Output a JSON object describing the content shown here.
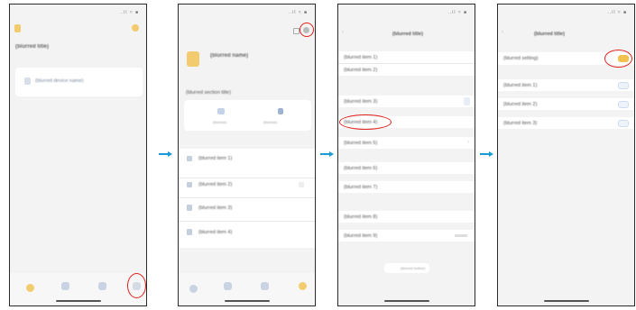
{
  "colors": {
    "accent": "#f2c14e",
    "arrow": "#1a9ad6",
    "highlight": "#e0221e",
    "frame": "#2a2a2a"
  },
  "screen1": {
    "status": "..il ≈ ■",
    "title": "(blurred title)",
    "list_item": "(blurred device name)"
  },
  "screen2": {
    "status": "..il ≈ ■",
    "profile_name": "(blurred name)",
    "section_title": "(blurred section title)",
    "shortcut_left": "(blurred)",
    "shortcut_right": "(blurred)",
    "menu": [
      "(blurred item 1)",
      "(blurred item 2)",
      "(blurred item 3)",
      "(blurred item 4)"
    ]
  },
  "screen3": {
    "status": "..il ≈ ■",
    "title": "(blurred title)",
    "items": [
      "(blurred item 1)",
      "(blurred item 2)",
      "(blurred item 3)",
      "(blurred item 4)",
      "(blurred item 5)",
      "(blurred item 6)",
      "(blurred item 7)",
      "(blurred item 8)",
      "(blurred item 9)"
    ],
    "button": "(blurred button)"
  },
  "screen4": {
    "status": "..il ≈ ■",
    "title": "(blurred title)",
    "master_toggle_label": "(blurred setting)",
    "items": [
      "(blurred item 1)",
      "(blurred item 2)",
      "(blurred item 3)"
    ]
  },
  "icons": {
    "back": "back-arrow-icon",
    "settings": "gear-icon",
    "chevron": "chevron-right-icon"
  }
}
